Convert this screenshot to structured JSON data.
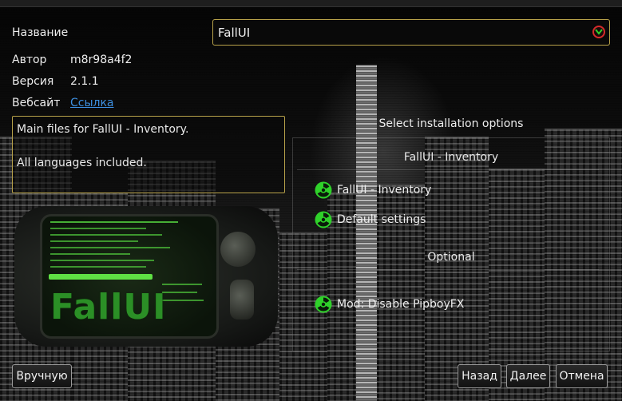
{
  "header": {
    "name_label": "Название",
    "name_value": "FallUI",
    "author_label": "Автор",
    "author_value": "m8r98a4f2",
    "version_label": "Версия",
    "version_value": "2.1.1",
    "website_label": "Вебсайт",
    "website_link": "Ссылка"
  },
  "description": {
    "line1": "Main files for FallUI - Inventory.",
    "line2": "All languages included."
  },
  "preview": {
    "logo_text": "FallUI"
  },
  "options": {
    "title": "Select installation options",
    "groups": [
      {
        "title": "FallUI - Inventory",
        "items": [
          {
            "label": "FallUI - Inventory",
            "selected": true
          },
          {
            "label": "Default settings",
            "selected": true
          }
        ]
      },
      {
        "title": "Optional",
        "items": [
          {
            "label": "Mod: Disable PipboyFX",
            "selected": true
          }
        ]
      }
    ]
  },
  "buttons": {
    "manual": "Вручную",
    "back": "Назад",
    "next": "Далее",
    "cancel": "Отмена"
  },
  "colors": {
    "accent_border": "#b8a24a",
    "radio_green": "#2fd12a",
    "link": "#3d8fe0",
    "dropdown_icon": "#d62b2b"
  },
  "icons": {
    "dropdown": "chevron-down-icon",
    "option_marker": "radiation-icon"
  }
}
